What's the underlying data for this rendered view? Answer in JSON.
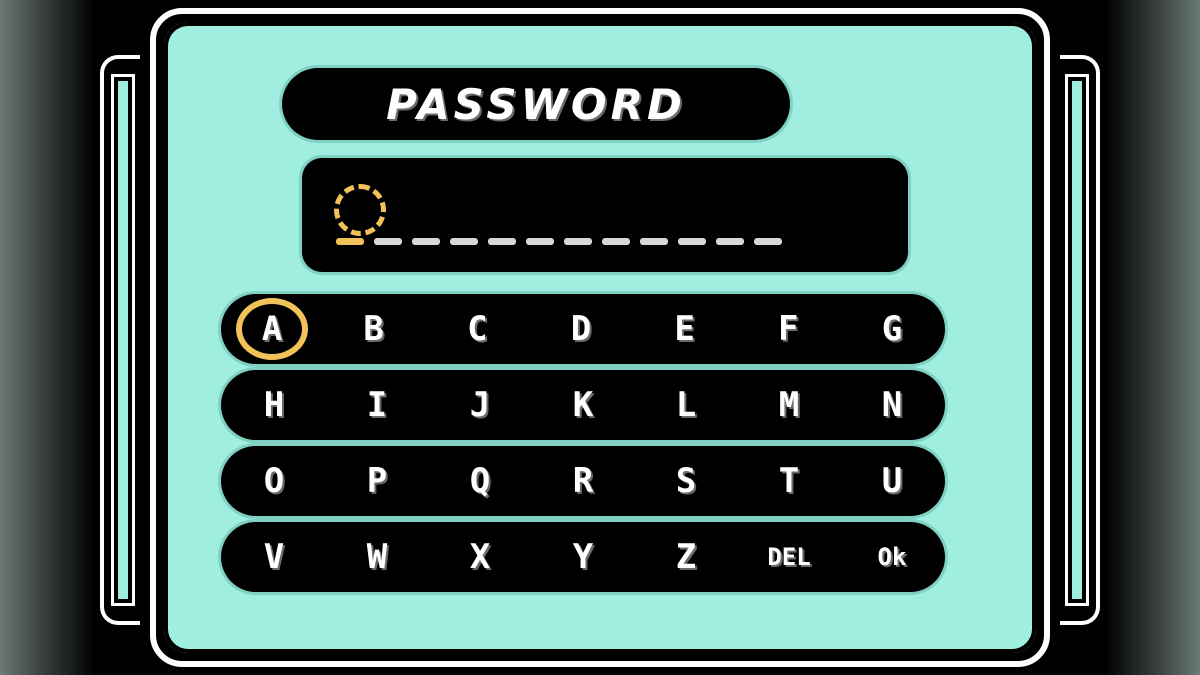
{
  "screen": {
    "title": "PASSWORD",
    "accent_color": "#9feee0",
    "highlight_color": "#f2c25a",
    "entry": {
      "slot_count": 12,
      "active_slot": 1,
      "value": ""
    },
    "keyboard": {
      "selected_key": "A",
      "rows": [
        [
          "A",
          "B",
          "C",
          "D",
          "E",
          "F",
          "G"
        ],
        [
          "H",
          "I",
          "J",
          "K",
          "L",
          "M",
          "N"
        ],
        [
          "O",
          "P",
          "Q",
          "R",
          "S",
          "T",
          "U"
        ],
        [
          "V",
          "W",
          "X",
          "Y",
          "Z",
          "DEL",
          "OK"
        ]
      ]
    }
  }
}
